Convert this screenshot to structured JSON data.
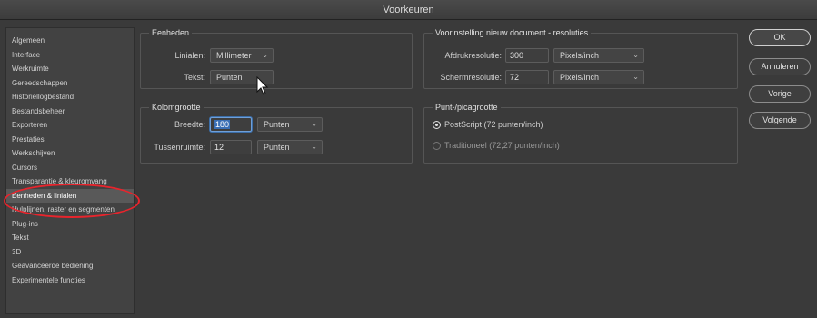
{
  "window": {
    "title": "Voorkeuren"
  },
  "sidebar": {
    "items": [
      {
        "label": "Algemeen"
      },
      {
        "label": "Interface"
      },
      {
        "label": "Werkruimte"
      },
      {
        "label": "Gereedschappen"
      },
      {
        "label": "Historiellogbestand"
      },
      {
        "label": "Bestandsbeheer"
      },
      {
        "label": "Exporteren"
      },
      {
        "label": "Prestaties"
      },
      {
        "label": "Werkschijven"
      },
      {
        "label": "Cursors"
      },
      {
        "label": "Transparantie & kleuromvang"
      },
      {
        "label": "Eenheden & linialen"
      },
      {
        "label": "Hulplijnen, raster en segmenten"
      },
      {
        "label": "Plug-ins"
      },
      {
        "label": "Tekst"
      },
      {
        "label": "3D"
      },
      {
        "label": "Geavanceerde bediening"
      },
      {
        "label": "Experimentele functies"
      }
    ],
    "active_index": 11
  },
  "units": {
    "title": "Eenheden",
    "rulers_label": "Linialen:",
    "rulers_value": "Millimeter",
    "type_label": "Tekst:",
    "type_value": "Punten"
  },
  "column_size": {
    "title": "Kolomgrootte",
    "width_label": "Breedte:",
    "width_value": "180",
    "width_unit": "Punten",
    "gutter_label": "Tussenruimte:",
    "gutter_value": "12",
    "gutter_unit": "Punten"
  },
  "new_doc_res": {
    "title": "Voorinstelling nieuw document - resoluties",
    "print_label": "Afdrukresolutie:",
    "print_value": "300",
    "print_unit": "Pixels/inch",
    "screen_label": "Schermresolutie:",
    "screen_value": "72",
    "screen_unit": "Pixels/inch"
  },
  "point_size": {
    "title": "Punt-/picagrootte",
    "options": [
      {
        "label": "PostScript (72 punten/inch)",
        "selected": true
      },
      {
        "label": "Traditioneel (72,27 punten/inch)",
        "selected": false
      }
    ]
  },
  "buttons": {
    "ok": "OK",
    "cancel": "Annuleren",
    "prev": "Vorige",
    "next": "Volgende"
  },
  "colors": {
    "annotation": "#e8242c",
    "selection": "#3a6fb5"
  }
}
